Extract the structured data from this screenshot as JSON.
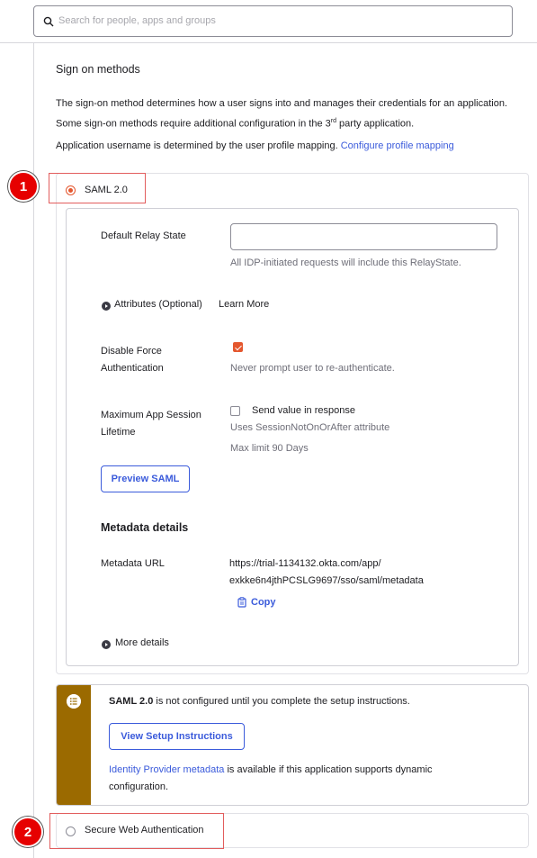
{
  "search": {
    "placeholder": "Search for people, apps and groups"
  },
  "section": {
    "title": "Sign on methods",
    "description_pre": "The sign-on method determines how a user signs into and manages their credentials for an application. Some sign-on methods require additional configuration in the 3",
    "description_sup": "rd",
    "description_post": " party application.",
    "username_note": "Application username is determined by the user profile mapping.",
    "configure_link": "Configure profile mapping"
  },
  "methods": {
    "saml": {
      "label": "SAML 2.0",
      "selected": true
    },
    "swa": {
      "label": "Secure Web Authentication",
      "selected": false
    }
  },
  "saml_settings": {
    "relay_state_label": "Default Relay State",
    "relay_state_value": "",
    "relay_state_hint": "All IDP-initiated requests will include this RelayState.",
    "attributes_label": "Attributes (Optional)",
    "learn_more": "Learn More",
    "disable_force_label_1": "Disable Force",
    "disable_force_label_2": "Authentication",
    "disable_force_checked": true,
    "disable_force_hint": "Never prompt user to re-authenticate.",
    "max_session_label_1": "Maximum App Session",
    "max_session_label_2": "Lifetime",
    "send_value_label": "Send value in response",
    "send_value_checked": false,
    "send_value_hint": "Uses SessionNotOnOrAfter attribute",
    "max_limit": "Max limit 90 Days",
    "preview_button": "Preview SAML"
  },
  "metadata": {
    "title": "Metadata details",
    "url_label": "Metadata URL",
    "url_line1": "https://trial-1134132.okta.com/app/",
    "url_line2": "exkke6n4jthPCSLG9697/sso/saml/metadata",
    "copy_label": "Copy",
    "more_details": "More details"
  },
  "notice": {
    "strong": "SAML 2.0",
    "text": " is not configured until you complete the setup instructions.",
    "button": "View Setup Instructions",
    "idp_link": "Identity Provider metadata",
    "idp_text_1": " is available if this application supports dynamic",
    "idp_text_2": "configuration."
  },
  "annotations": {
    "badge1": "1",
    "badge2": "2"
  },
  "colors": {
    "accent": "#3b5bdb",
    "radio_selected": "#e4572e",
    "notice_bar": "#9b6a00",
    "annotation": "#e60000"
  }
}
